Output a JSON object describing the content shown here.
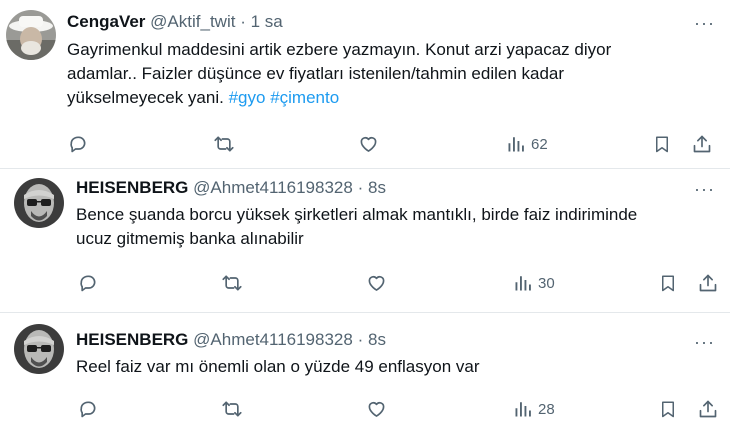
{
  "tweets": [
    {
      "name": "CengaVer",
      "handle": "@Aktif_twit",
      "separator": "·",
      "time": "1 sa",
      "text_line1": "Gayrimenkul maddesini artik ezbere yazmayın. Konut arzi yapacaz diyor",
      "text_line2": "adamlar.. Faizler düşünce ev fiyatları istenilen/tahmin edilen kadar",
      "text_line3": "yükselmeyecek yani.",
      "hashtag1": "#gyo",
      "hashtag2": "#çimento",
      "views": "62",
      "more": "···"
    },
    {
      "name": "HEISENBERG",
      "handle": "@Ahmet4116198328",
      "separator": "·",
      "time": "8s",
      "text_line1": "Bence şuanda borcu yüksek şirketleri almak mantıklı,  birde faiz indiriminde",
      "text_line2": "ucuz gitmemiş banka alınabilir",
      "views": "30",
      "more": "···"
    },
    {
      "name": "HEISENBERG",
      "handle": "@Ahmet4116198328",
      "separator": "·",
      "time": "8s",
      "text_line1": "Reel faiz var mı önemli olan o yüzde 49 enflasyon var",
      "views": "28",
      "more": "···"
    }
  ],
  "icons": {
    "reply": "reply-icon",
    "retweet": "retweet-icon",
    "like": "like-icon",
    "views": "views-icon",
    "bookmark": "bookmark-icon",
    "share": "share-icon"
  },
  "colors": {
    "text": "#0f1419",
    "secondary": "#536471",
    "link": "#1d9bf0",
    "divider": "#e4e8eb"
  }
}
